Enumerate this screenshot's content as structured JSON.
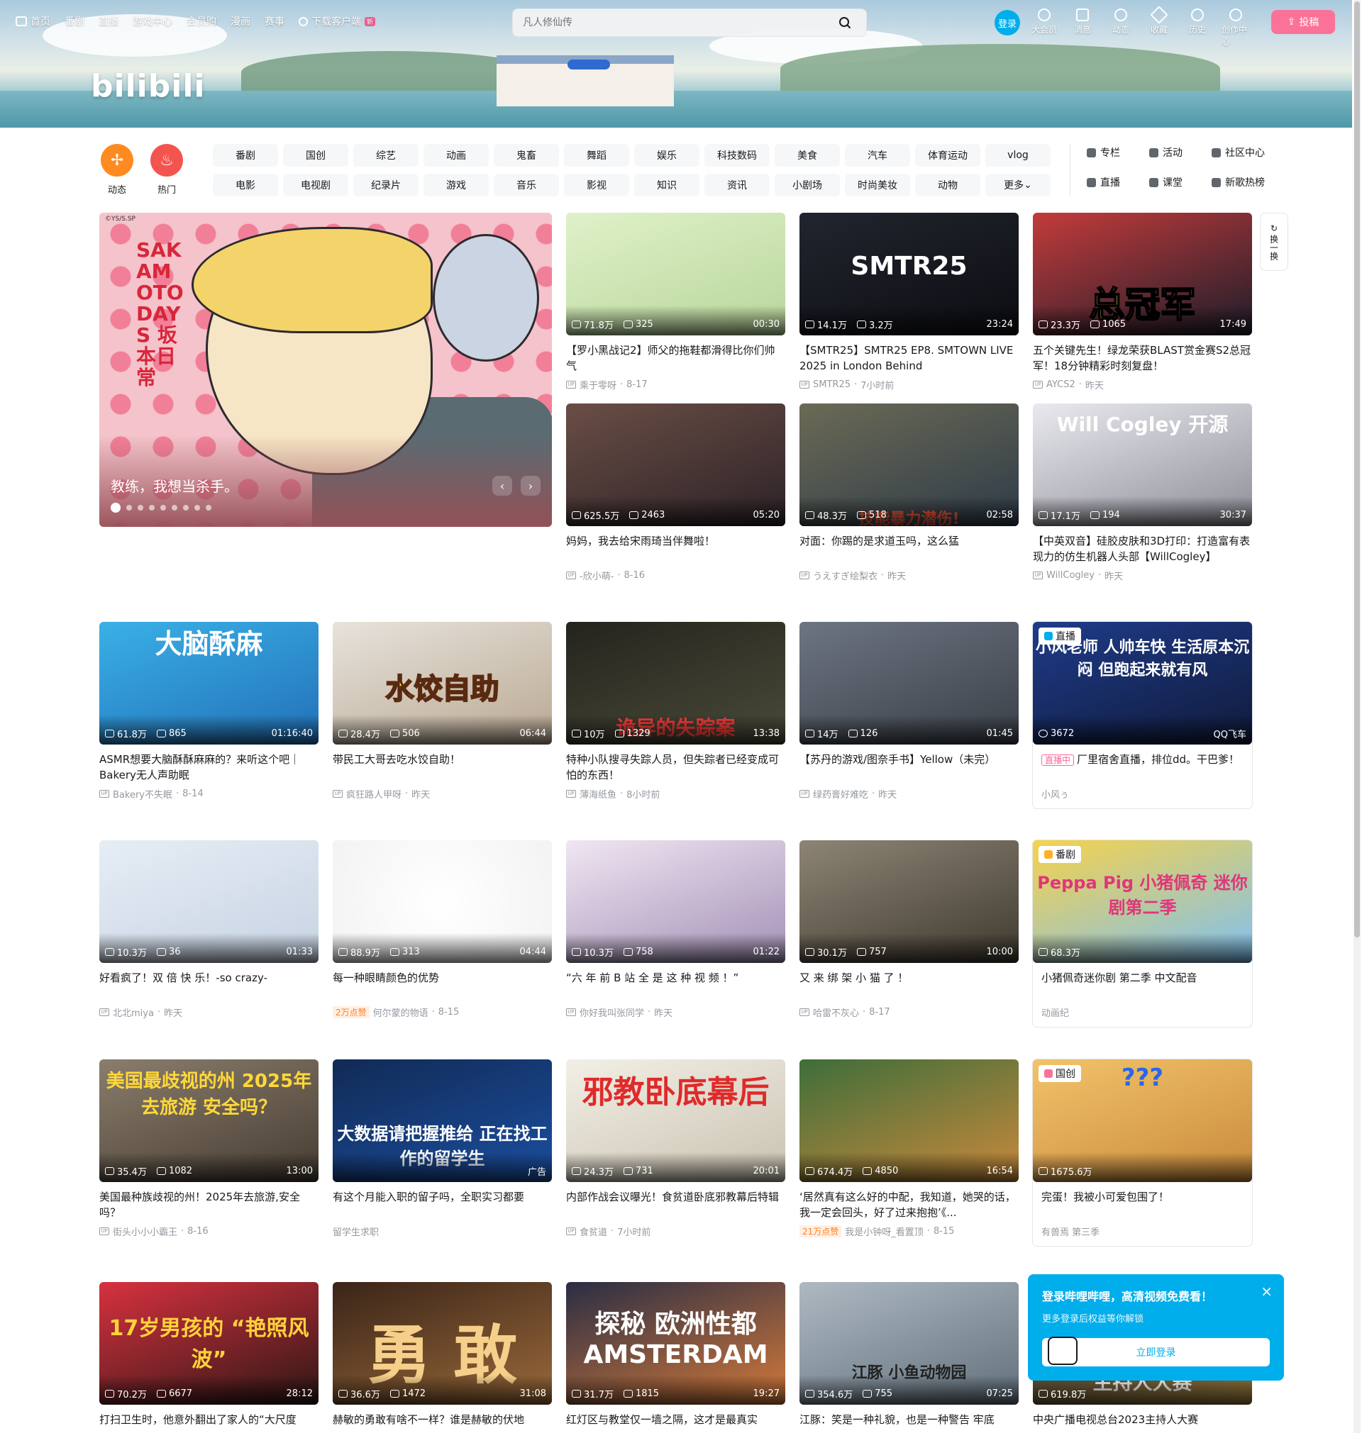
{
  "header": {
    "nav": [
      "首页",
      "番剧",
      "直播",
      "游戏中心",
      "会员购",
      "漫画",
      "赛事"
    ],
    "download_label": "下载客户端",
    "download_badge": "新",
    "logo": "bilibili",
    "search_placeholder": "凡人修仙传",
    "login_label": "登录",
    "right_nav": [
      "大会员",
      "消息",
      "动态",
      "收藏",
      "历史",
      "创作中心"
    ],
    "upload_label": "投稿"
  },
  "channels": {
    "dynamic_label": "动态",
    "hot_label": "热门",
    "chips": [
      "番剧",
      "国创",
      "综艺",
      "动画",
      "鬼畜",
      "舞蹈",
      "娱乐",
      "科技数码",
      "美食",
      "汽车",
      "体育运动",
      "vlog",
      "电影",
      "电视剧",
      "纪录片",
      "游戏",
      "音乐",
      "影视",
      "知识",
      "资讯",
      "小剧场",
      "时尚美妆",
      "动物",
      "更多"
    ],
    "side_links": [
      "专栏",
      "活动",
      "社区中心",
      "直播",
      "课堂",
      "新歌热榜"
    ]
  },
  "carousel": {
    "credit": "©YS/S.SP",
    "art_title": "SAKAMOTO DAYS 坂本日常",
    "caption": "教练，我想当杀手。",
    "dot_count": 9
  },
  "refresh_label": "换一换",
  "cards": [
    {
      "title": "【罗小黑战记2】师父的拖鞋都滑得比你们帅气",
      "views": "71.8万",
      "danmaku": "325",
      "duration": "00:30",
      "author": "乘于零呀",
      "date": "8-17"
    },
    {
      "title": "【SMTR25】SMTR25 EP8. SMTOWN LIVE 2025 in London Behind",
      "views": "14.1万",
      "danmaku": "3.2万",
      "duration": "23:24",
      "author": "SMTR25",
      "date": "7小时前",
      "art_text": "SMTR25"
    },
    {
      "title": "五个关键先生！绿龙荣获BLAST赏金赛S2总冠军！18分钟精彩时刻复盘！",
      "views": "23.3万",
      "danmaku": "1065",
      "duration": "17:49",
      "author": "AYCS2",
      "date": "昨天",
      "art_text": "总冠军"
    },
    {
      "title": "妈妈，我去给宋雨琦当伴舞啦！",
      "views": "625.5万",
      "danmaku": "2463",
      "duration": "05:20",
      "author": "-欣小萌-",
      "date": "8-16"
    },
    {
      "title": "对面：你踢的是求道玉吗，这么猛",
      "views": "48.3万",
      "danmaku": "518",
      "duration": "02:58",
      "author": "うえすぎ绘梨衣",
      "date": "昨天",
      "art_text": "技能暴力潜伤!"
    },
    {
      "title": "【中英双音】硅胶皮肤和3D打印：打造富有表现力的仿生机器人头部【WillCogley】",
      "views": "17.1万",
      "danmaku": "194",
      "duration": "30:37",
      "author": "WillCogley",
      "date": "昨天",
      "art_text": "Will Cogley 开源"
    },
    {
      "title": "ASMR想要大脑酥酥麻麻的？来听这个吧｜Bakery无人声助眠",
      "views": "61.8万",
      "danmaku": "865",
      "duration": "01:16:40",
      "author": "Bakery不失眠",
      "date": "8-14",
      "art_text": "大脑酥麻"
    },
    {
      "title": "带民工大哥去吃水饺自助！",
      "views": "28.4万",
      "danmaku": "506",
      "duration": "06:44",
      "author": "疯狂路人甲呀",
      "date": "昨天",
      "art_text": "水饺自助"
    },
    {
      "title": "特种小队搜寻失踪人员，但失踪者已经变成可怕的东西！",
      "views": "10万",
      "danmaku": "1329",
      "duration": "13:38",
      "author": "薄海纸鱼",
      "date": "8小时前",
      "art_text": "诡异的失踪案"
    },
    {
      "title": "【苏丹的游戏/图奈手书】Yellow（未完）",
      "views": "14万",
      "danmaku": "126",
      "duration": "01:45",
      "author": "绿药膏好难吃",
      "date": "昨天"
    },
    {
      "title": "厂里宿舍直播，排位dd。干巴爹！",
      "viewers": "3672",
      "platform": "QQ飞车",
      "author": "小风ぅ",
      "live_label": "直播中",
      "tag": "直播",
      "art_text": "小风老师 人帅车快 生活原本沉闷 但跑起来就有风"
    },
    {
      "title": "好看疯了！双 倍 快 乐！-so crazy-",
      "views": "10.3万",
      "danmaku": "36",
      "duration": "01:33",
      "author": "北北miya",
      "date": "昨天"
    },
    {
      "title": "每一种眼睛颜色的优势",
      "views": "88.9万",
      "danmaku": "313",
      "duration": "04:44",
      "author": "何尔蒙的物语",
      "date": "8-15",
      "likes": "2万点赞"
    },
    {
      "title": "“六 年 前 B 站 全 是 这 种 视 频 ！”",
      "views": "10.3万",
      "danmaku": "758",
      "duration": "01:22",
      "author": "你好我叫张同学",
      "date": "昨天"
    },
    {
      "title": "又 来 绑 架 小 猫 了 ！",
      "views": "30.1万",
      "danmaku": "757",
      "duration": "10:00",
      "author": "哈雷不灰心",
      "date": "8-17"
    },
    {
      "title": "小猪佩奇迷你剧 第二季 中文配音",
      "views": "68.3万",
      "author": "动画纪",
      "tag": "番剧",
      "art_text": "Peppa Pig 小猪佩奇 迷你剧第二季"
    },
    {
      "title": "美国最种族歧视的州！2025年去旅游,安全吗？",
      "views": "35.4万",
      "danmaku": "1082",
      "duration": "13:00",
      "author": "街头小小小霸王",
      "date": "8-16",
      "art_text": "美国最歧视的州 2025年去旅游 安全吗？"
    },
    {
      "title": "有这个月能入职的留子吗，全职实习都要",
      "author": "留学生求职",
      "ad_label": "广告",
      "art_text": "大数据请把握推给 正在找工作的留学生"
    },
    {
      "title": "内部作战会议曝光！食贫道卧底邪教幕后特辑",
      "views": "24.3万",
      "danmaku": "731",
      "duration": "20:01",
      "author": "食贫道",
      "date": "7小时前",
      "art_text": "邪教卧底幕后"
    },
    {
      "title": "‘居然真有这么好的中配，我知道，她哭的话，我一定会回头，好了过来抱抱’《...",
      "views": "674.4万",
      "danmaku": "4850",
      "duration": "16:54",
      "author": "我是小钟呀_看置顶",
      "date": "8-15",
      "likes": "21万点赞"
    },
    {
      "title": "完蛋！我被小可爱包围了！",
      "views": "1675.6万",
      "author": "有兽焉 第三季",
      "tag": "国创",
      "art_text": "???"
    },
    {
      "title": "打扫卫生时，他意外翻出了家人的“大尺度",
      "views": "70.2万",
      "danmaku": "6677",
      "duration": "28:12",
      "art_text": "17岁男孩的 “艳照风波”"
    },
    {
      "title": "赫敏的勇敢有啥不一样？谁是赫敏的伏地",
      "views": "36.6万",
      "danmaku": "1472",
      "duration": "31:08",
      "art_text": "勇 敢"
    },
    {
      "title": "红灯区与教堂仅一墙之隔，这才是最真实",
      "views": "31.7万",
      "danmaku": "1815",
      "duration": "19:27",
      "art_text": "探秘 欧洲性都 AMSTERDAM"
    },
    {
      "title": "江豚：笑是一种礼貌，也是一种警告 牢底",
      "views": "354.6万",
      "danmaku": "755",
      "duration": "07:25",
      "art_text": "江豚 小鱼动物园"
    },
    {
      "title": "中央广播电视总台2023主持人大赛",
      "views": "619.8万",
      "art_text": "主持人大赛"
    }
  ],
  "popup": {
    "title": "登录哔哩哔哩，高清视频免费看！",
    "subtitle": "更多登录后权益等你解锁",
    "button": "立即登录",
    "close": "×"
  },
  "colors": {
    "brand_pink": "#fb7299",
    "brand_blue": "#00aeec",
    "hot_orange": "#ff8a1f",
    "hot_red": "#f4544f"
  }
}
